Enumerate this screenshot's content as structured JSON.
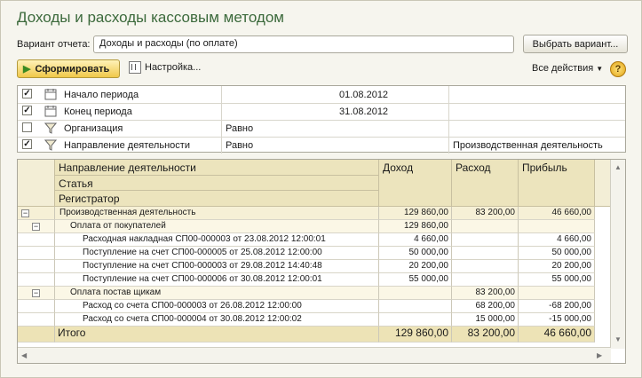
{
  "window": {
    "title": "Доходы и расходы кассовым методом"
  },
  "variant": {
    "label": "Вариант отчета:",
    "value": "Доходы и расходы (по оплате)",
    "choose_button": "Выбрать вариант..."
  },
  "toolbar": {
    "run_button": "Сформировать",
    "settings_button": "Настройка...",
    "all_actions": "Все действия",
    "help": "?"
  },
  "settings": [
    {
      "checked": true,
      "name": "Начало периода",
      "comparison": "",
      "value": "01.08.2012"
    },
    {
      "checked": true,
      "name": "Конец периода",
      "comparison": "",
      "value": "31.08.2012"
    },
    {
      "checked": false,
      "name": "Организация",
      "comparison": "Равно",
      "value": ""
    },
    {
      "checked": true,
      "name": "Направление деятельности",
      "comparison": "Равно",
      "value": "Производственная деятельность"
    }
  ],
  "report": {
    "headers": {
      "group1": "Направление деятельности",
      "group2": "Статья",
      "group3": "Регистратор",
      "income": "Доход",
      "expense": "Расход",
      "profit": "Прибыль"
    },
    "rows": [
      {
        "level": 1,
        "name": "Производственная деятельность",
        "income": "129 860,00",
        "expense": "83 200,00",
        "profit": "46 660,00"
      },
      {
        "level": 2,
        "name": "Оплата от покупателей",
        "income": "129 860,00",
        "expense": "",
        "profit": ""
      },
      {
        "level": 3,
        "name": "Расходная накладная СП00-000003 от 23.08.2012 12:00:01",
        "income": "4 660,00",
        "expense": "",
        "profit": "4 660,00"
      },
      {
        "level": 3,
        "name": "Поступление на счет СП00-000005 от 25.08.2012 12:00:00",
        "income": "50 000,00",
        "expense": "",
        "profit": "50 000,00"
      },
      {
        "level": 3,
        "name": "Поступление на счет СП00-000003 от 29.08.2012 14:40:48",
        "income": "20 200,00",
        "expense": "",
        "profit": "20 200,00"
      },
      {
        "level": 3,
        "name": "Поступление на счет СП00-000006 от 30.08.2012 12:00:01",
        "income": "55 000,00",
        "expense": "",
        "profit": "55 000,00"
      },
      {
        "level": 2,
        "name": "Оплата постав щикам",
        "income": "",
        "expense": "83 200,00",
        "profit": ""
      },
      {
        "level": 3,
        "name": "Расход со счета СП00-000003 от 26.08.2012 12:00:00",
        "income": "",
        "expense": "68 200,00",
        "profit": "-68 200,00"
      },
      {
        "level": 3,
        "name": "Расход со счета СП00-000004 от 30.08.2012 12:00:02",
        "income": "",
        "expense": "15 000,00",
        "profit": "-15 000,00"
      }
    ],
    "total": {
      "name": "Итого",
      "income": "129 860,00",
      "expense": "83 200,00",
      "profit": "46 660,00"
    }
  }
}
